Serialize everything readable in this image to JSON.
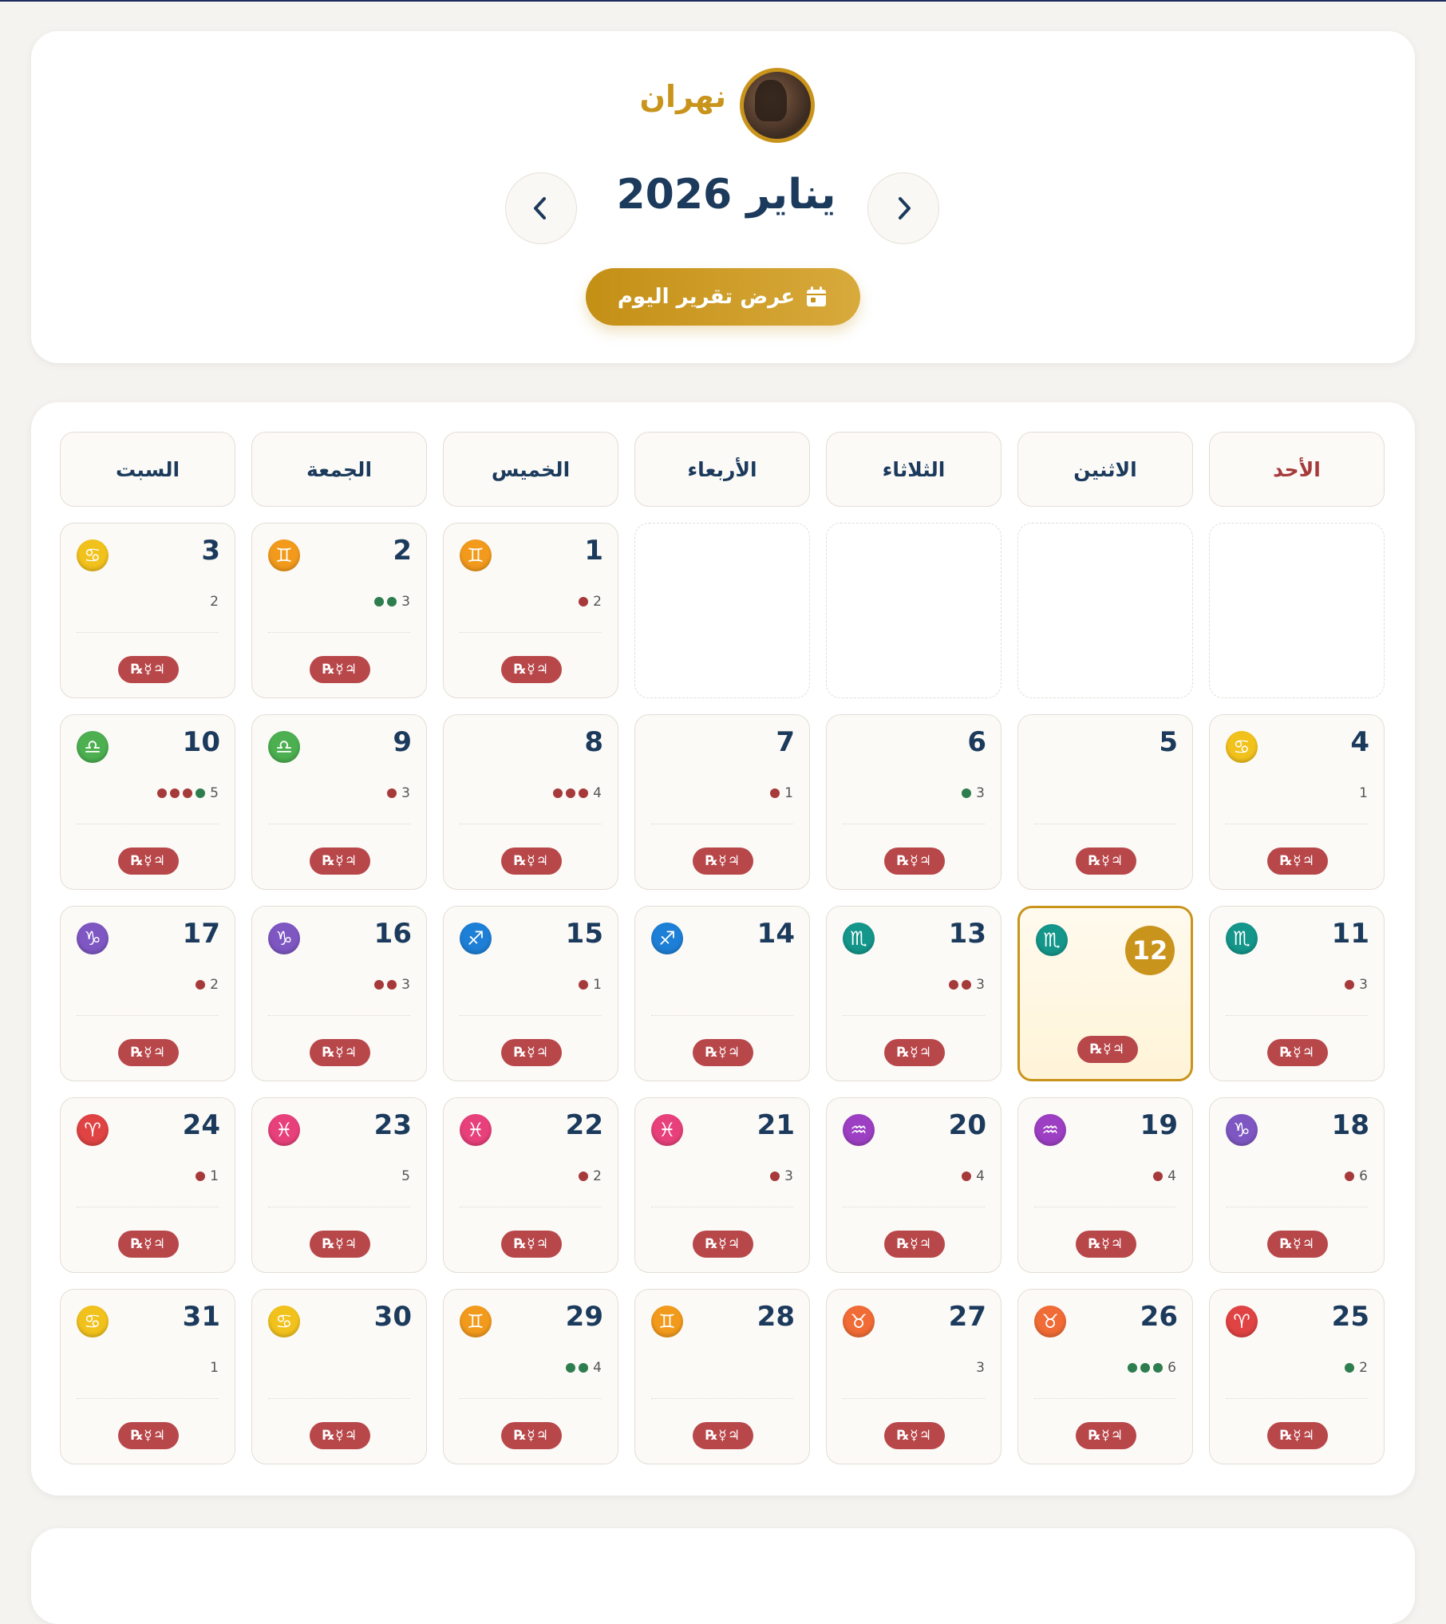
{
  "profile": {
    "name": "نهران"
  },
  "header": {
    "month_title": "يناير 2026",
    "report_button": "عرض تقرير اليوم"
  },
  "weekdays": [
    "الأحد",
    "الاثنين",
    "الثلاثاء",
    "الأربعاء",
    "الخميس",
    "الجمعة",
    "السبت"
  ],
  "retro_badge": "℞☿♃",
  "today": 12,
  "zodiac": {
    "aries": {
      "glyph": "♈",
      "color": "#e04343"
    },
    "taurus": {
      "glyph": "♉",
      "color": "#f06b35"
    },
    "gemini": {
      "glyph": "♊",
      "color": "#f29a1c"
    },
    "cancer": {
      "glyph": "♋",
      "color": "#f2c21c"
    },
    "libra": {
      "glyph": "♎",
      "color": "#4caf50"
    },
    "scorpio": {
      "glyph": "♏",
      "color": "#14968a"
    },
    "sagittarius": {
      "glyph": "♐",
      "color": "#1e7fd6"
    },
    "capricorn": {
      "glyph": "♑",
      "color": "#7e57c2"
    },
    "aquarius": {
      "glyph": "♒",
      "color": "#9c3fc2"
    },
    "pisces": {
      "glyph": "♓",
      "color": "#e8407a"
    }
  },
  "days": [
    {
      "day": 1,
      "sign": "gemini",
      "count": 2,
      "dots": [
        "red"
      ]
    },
    {
      "day": 2,
      "sign": "gemini",
      "count": 3,
      "dots": [
        "green",
        "green"
      ]
    },
    {
      "day": 3,
      "sign": "cancer",
      "count": 2,
      "dots": []
    },
    {
      "day": 4,
      "sign": "cancer",
      "count": 1,
      "dots": []
    },
    {
      "day": 5,
      "sign": "",
      "count": null,
      "dots": []
    },
    {
      "day": 6,
      "sign": "",
      "count": 3,
      "dots": [
        "green"
      ]
    },
    {
      "day": 7,
      "sign": "",
      "count": 1,
      "dots": [
        "red"
      ]
    },
    {
      "day": 8,
      "sign": "",
      "count": 4,
      "dots": [
        "red",
        "red",
        "red"
      ]
    },
    {
      "day": 9,
      "sign": "libra",
      "count": 3,
      "dots": [
        "red"
      ]
    },
    {
      "day": 10,
      "sign": "libra",
      "count": 5,
      "dots": [
        "red",
        "red",
        "red",
        "green"
      ]
    },
    {
      "day": 11,
      "sign": "scorpio",
      "count": 3,
      "dots": [
        "red"
      ]
    },
    {
      "day": 12,
      "sign": "scorpio",
      "count": null,
      "dots": []
    },
    {
      "day": 13,
      "sign": "scorpio",
      "count": 3,
      "dots": [
        "red",
        "red"
      ]
    },
    {
      "day": 14,
      "sign": "sagittarius",
      "count": null,
      "dots": []
    },
    {
      "day": 15,
      "sign": "sagittarius",
      "count": 1,
      "dots": [
        "red"
      ]
    },
    {
      "day": 16,
      "sign": "capricorn",
      "count": 3,
      "dots": [
        "red",
        "red"
      ]
    },
    {
      "day": 17,
      "sign": "capricorn",
      "count": 2,
      "dots": [
        "red"
      ]
    },
    {
      "day": 18,
      "sign": "capricorn",
      "count": 6,
      "dots": [
        "red"
      ]
    },
    {
      "day": 19,
      "sign": "aquarius",
      "count": 4,
      "dots": [
        "red"
      ]
    },
    {
      "day": 20,
      "sign": "aquarius",
      "count": 4,
      "dots": [
        "red"
      ]
    },
    {
      "day": 21,
      "sign": "pisces",
      "count": 3,
      "dots": [
        "red"
      ]
    },
    {
      "day": 22,
      "sign": "pisces",
      "count": 2,
      "dots": [
        "red"
      ]
    },
    {
      "day": 23,
      "sign": "pisces",
      "count": 5,
      "dots": []
    },
    {
      "day": 24,
      "sign": "aries",
      "count": 1,
      "dots": [
        "red"
      ]
    },
    {
      "day": 25,
      "sign": "aries",
      "count": 2,
      "dots": [
        "green"
      ]
    },
    {
      "day": 26,
      "sign": "taurus",
      "count": 6,
      "dots": [
        "green",
        "green",
        "green"
      ]
    },
    {
      "day": 27,
      "sign": "taurus",
      "count": 3,
      "dots": []
    },
    {
      "day": 28,
      "sign": "gemini",
      "count": null,
      "dots": []
    },
    {
      "day": 29,
      "sign": "gemini",
      "count": 4,
      "dots": [
        "green",
        "green"
      ]
    },
    {
      "day": 30,
      "sign": "cancer",
      "count": null,
      "dots": []
    },
    {
      "day": 31,
      "sign": "cancer",
      "count": 1,
      "dots": []
    }
  ]
}
